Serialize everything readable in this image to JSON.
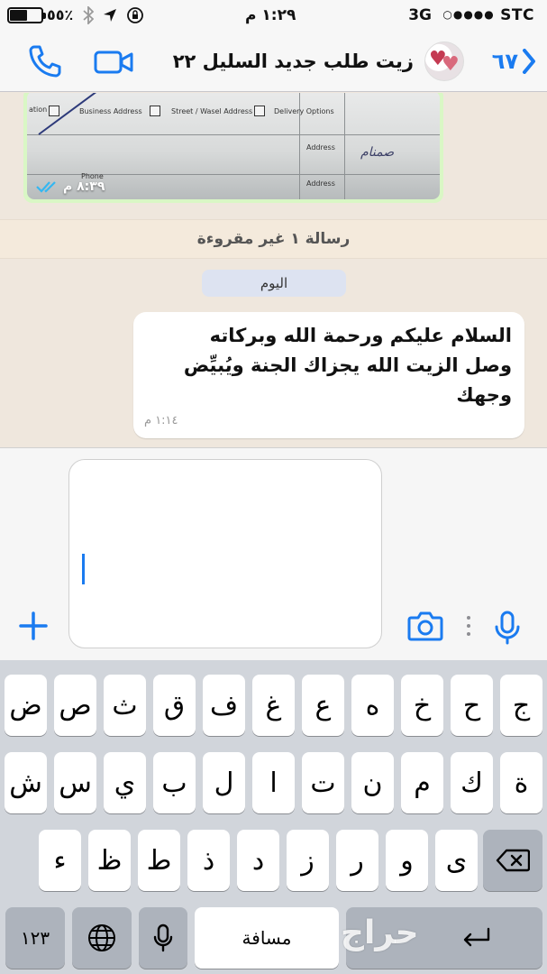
{
  "status_bar": {
    "carrier": "STC",
    "signal_dots": "○●●●●",
    "network": "3G",
    "time": "١:٢٩ م",
    "battery_percent": "٥٥٪",
    "battery_level": 0.55,
    "icons": [
      "bluetooth-icon",
      "location-icon",
      "rotation-lock-icon"
    ]
  },
  "nav": {
    "back_count": "٦٧",
    "chat_title": "زيت طلب جديد السليل ٢٢",
    "icons": [
      "back-chevron-icon",
      "video-call-icon",
      "phone-call-icon"
    ],
    "accent_color": "#1a7bf0"
  },
  "chat": {
    "image_message": {
      "time": "٨:٣٩ م",
      "status": "read",
      "document_labels": {
        "opt1": "ation",
        "opt2": "Business Address",
        "opt3": "Street / Wasel Address",
        "opt4": "Delivery Options",
        "addr1": "Address",
        "addr2": "Address",
        "phone": "Phone",
        "sig": "صمنام"
      }
    },
    "unread_banner": "رسالة ١ غير مقروءة",
    "date_separator": "اليوم",
    "text_message": {
      "text": "السلام عليكم ورحمة الله وبركاته\nوصل الزيت الله يجزاك الجنة ويُبيِّض\nوجهك",
      "time": "١:١٤ م"
    }
  },
  "input": {
    "value": "",
    "icons": [
      "plus-icon",
      "camera-icon",
      "more-dots-icon",
      "microphone-icon"
    ]
  },
  "keyboard": {
    "row1": [
      "ج",
      "ح",
      "خ",
      "ه",
      "ع",
      "غ",
      "ف",
      "ق",
      "ث",
      "ص",
      "ض"
    ],
    "row2": [
      "ة",
      "ك",
      "م",
      "ن",
      "ت",
      "ا",
      "ل",
      "ب",
      "ي",
      "س",
      "ش"
    ],
    "row3": [
      "ى",
      "و",
      "ر",
      "ز",
      "د",
      "ذ",
      "ط",
      "ظ",
      "ء"
    ],
    "numbers_key": "١٢٣",
    "space_key": "مسافة",
    "icons": [
      "backspace-icon",
      "globe-icon",
      "dictation-mic-icon",
      "return-icon"
    ]
  },
  "watermark": "حراج"
}
